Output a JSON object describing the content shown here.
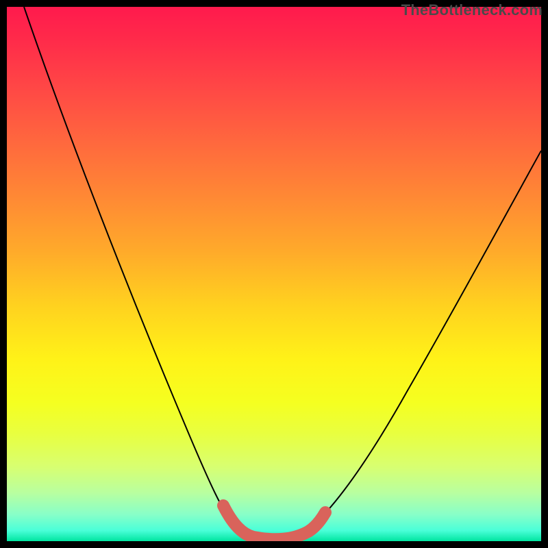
{
  "watermark": {
    "text": "TheBottleneck.com"
  },
  "chart_data": {
    "type": "line",
    "title": "",
    "xlabel": "",
    "ylabel": "",
    "ylim": [
      0,
      100
    ],
    "xlim": [
      0,
      100
    ],
    "series": [
      {
        "name": "bottleneck-curve",
        "x": [
          3,
          10,
          18,
          25,
          32,
          38,
          41,
          44,
          47,
          50,
          53,
          56,
          60,
          66,
          72,
          78,
          86,
          94,
          100
        ],
        "values": [
          100,
          84,
          68,
          54,
          40,
          26,
          16,
          8,
          3,
          0,
          0,
          3,
          8,
          18,
          30,
          42,
          56,
          68,
          78
        ]
      }
    ],
    "annotations": [
      {
        "name": "highlight-band",
        "x_range": [
          41,
          58
        ],
        "style": "thick-salmon"
      }
    ]
  },
  "colors": {
    "curve": "#000000",
    "highlight": "#d9635b",
    "frame": "#000000"
  }
}
